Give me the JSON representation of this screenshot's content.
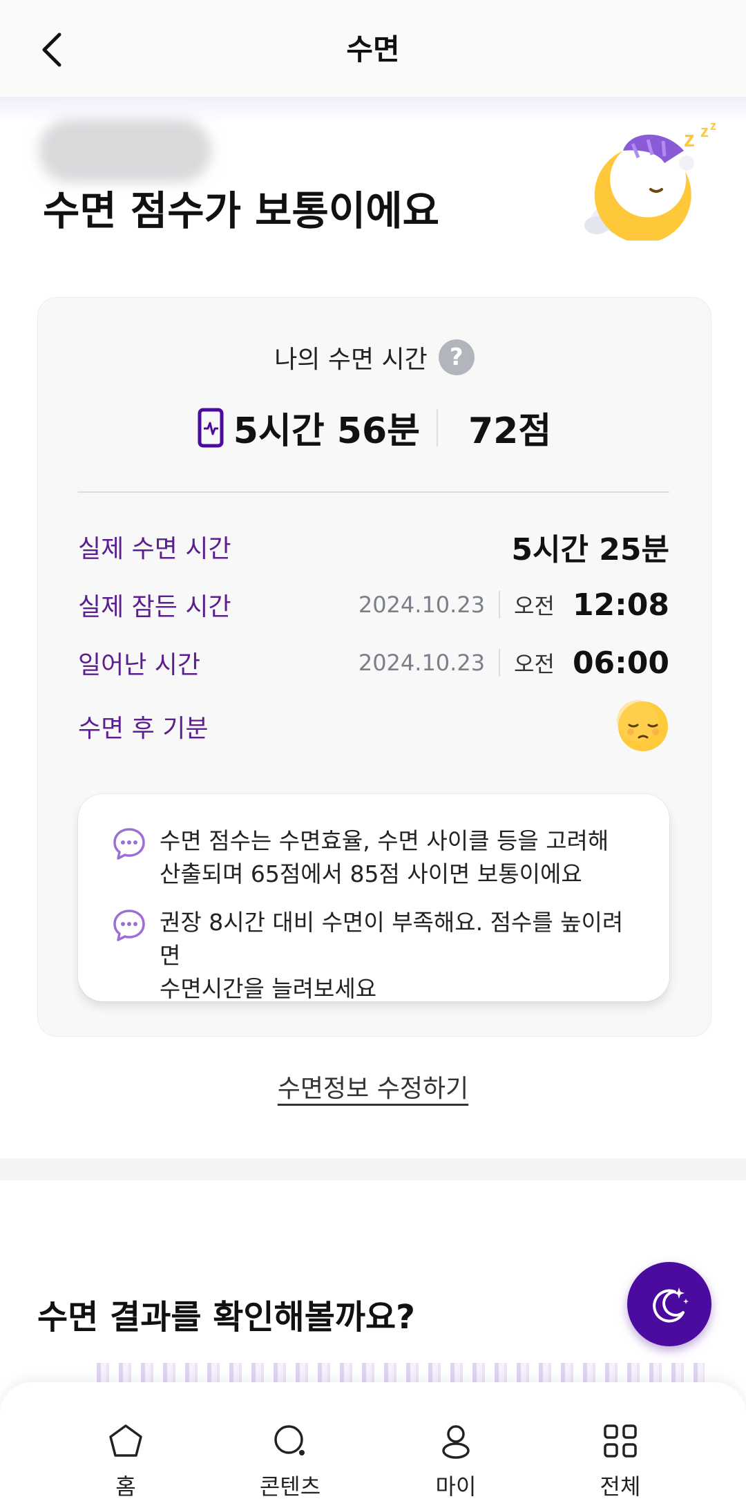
{
  "header": {
    "title": "수면"
  },
  "hero": {
    "title": "수면 점수가 보통이에요"
  },
  "card": {
    "label": "나의 수면 시간",
    "help_symbol": "?",
    "total_time": "5시간 56분",
    "score": "72점",
    "rows": [
      {
        "label": "실제 수면 시간",
        "value": "5시간 25분"
      },
      {
        "label": "실제 잠든 시간",
        "date": "2024.10.23",
        "ampm": "오전",
        "time": "12:08"
      },
      {
        "label": "일어난 시간",
        "date": "2024.10.23",
        "ampm": "오전",
        "time": "06:00"
      },
      {
        "label": "수면 후 기분",
        "mood": "sleepy-face-icon"
      }
    ],
    "notes": [
      {
        "line1": "수면 점수는 수면효율, 수면 사이클 등을 고려해",
        "line2": "산출되며 65점에서 85점 사이면 보통이에요"
      },
      {
        "line1": "권장 8시간 대비 수면이 부족해요. 점수를 높이려면",
        "line2": "수면시간을 늘려보세요"
      }
    ]
  },
  "edit_link": "수면정보 수정하기",
  "result_section": {
    "title": "수면 결과를 확인해볼까요?"
  },
  "bottom_nav": [
    {
      "label": "홈",
      "icon": "home-icon"
    },
    {
      "label": "콘텐츠",
      "icon": "search-icon"
    },
    {
      "label": "마이",
      "icon": "user-icon"
    },
    {
      "label": "전체",
      "icon": "grid-icon"
    }
  ],
  "colors": {
    "accent": "#4a0b9e",
    "label_purple": "#5b1e8f",
    "note_icon": "#9c6fd6",
    "mood_face": "#ffc93c"
  }
}
